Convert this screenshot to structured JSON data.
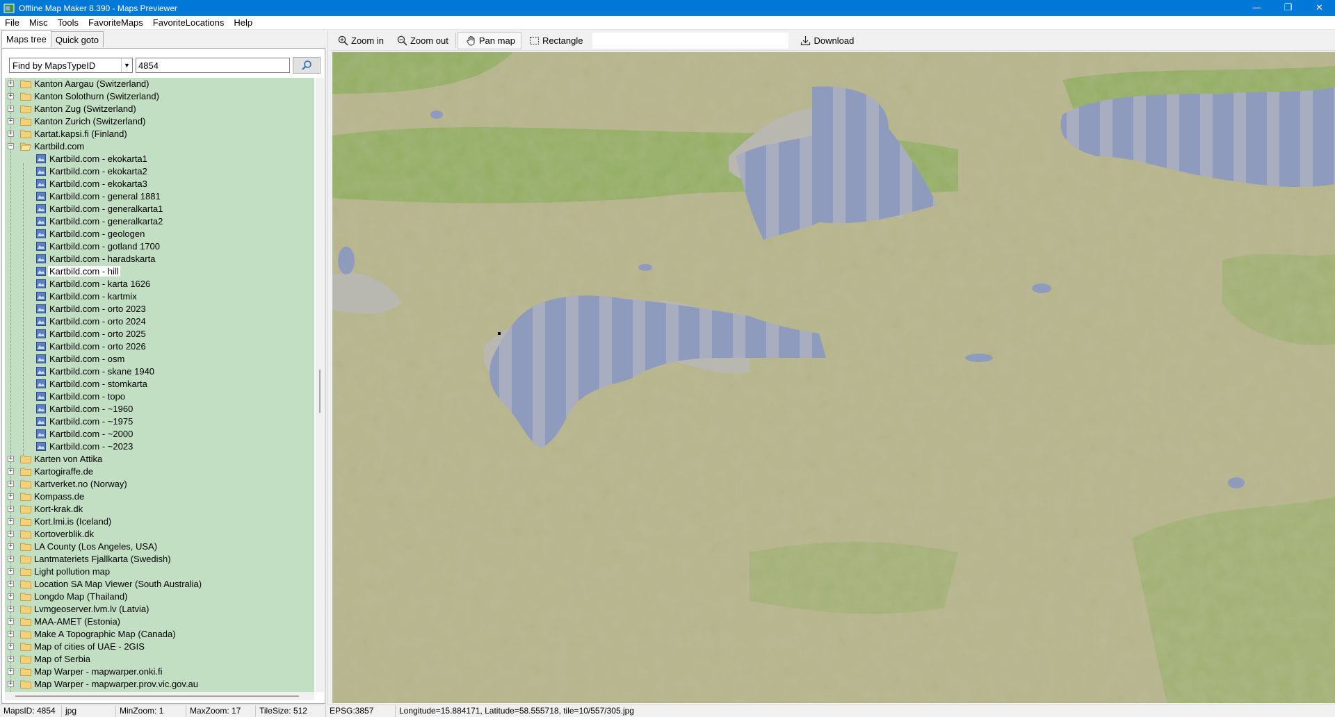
{
  "window": {
    "title": "Offline Map Maker 8.390 - Maps Previewer",
    "minimize": "—",
    "restore": "❐",
    "close": "✕"
  },
  "menu": [
    {
      "label": "File"
    },
    {
      "label": "Misc"
    },
    {
      "label": "Tools"
    },
    {
      "label": "FavoriteMaps"
    },
    {
      "label": "FavoriteLocations"
    },
    {
      "label": "Help"
    }
  ],
  "tabs": {
    "maps_tree": "Maps tree",
    "quick_goto": "Quick goto"
  },
  "search": {
    "mode": "Find by MapsTypeID",
    "value": "4854"
  },
  "tree": {
    "before": [
      "Kanton Aargau (Switzerland)",
      "Kanton Solothurn (Switzerland)",
      "Kanton Zug (Switzerland)",
      "Kanton Zurich (Switzerland)",
      "Kartat.kapsi.fi (Finland)"
    ],
    "expanded": "Kartbild.com",
    "children": [
      "Kartbild.com - ekokarta1",
      "Kartbild.com - ekokarta2",
      "Kartbild.com - ekokarta3",
      "Kartbild.com - general 1881",
      "Kartbild.com - generalkarta1",
      "Kartbild.com - generalkarta2",
      "Kartbild.com - geologen",
      "Kartbild.com - gotland 1700",
      "Kartbild.com - haradskarta",
      "Kartbild.com - hill",
      "Kartbild.com - karta 1626",
      "Kartbild.com - kartmix",
      "Kartbild.com - orto 2023",
      "Kartbild.com - orto 2024",
      "Kartbild.com - orto 2025",
      "Kartbild.com - orto 2026",
      "Kartbild.com - osm",
      "Kartbild.com - skane 1940",
      "Kartbild.com - stomkarta",
      "Kartbild.com - topo",
      "Kartbild.com - ~1960",
      "Kartbild.com - ~1975",
      "Kartbild.com - ~2000",
      "Kartbild.com - ~2023"
    ],
    "selected_index": 9,
    "after": [
      "Karten von Attika",
      "Kartogiraffe.de",
      "Kartverket.no (Norway)",
      "Kompass.de",
      "Kort-krak.dk",
      "Kort.lmi.is (Iceland)",
      "Kortoverblik.dk",
      "LA County (Los Angeles, USA)",
      "Lantmateriets Fjallkarta (Swedish)",
      "Light pollution map",
      "Location SA Map Viewer (South Australia)",
      "Longdo Map (Thailand)",
      "Lvmgeoserver.lvm.lv (Latvia)",
      "MAA-AMET (Estonia)",
      "Make A Topographic Map (Canada)",
      "Map of cities of UAE - 2GIS",
      "Map of Serbia",
      "Map Warper - mapwarper.onki.fi",
      "Map Warper - mapwarper.prov.vic.gov.au"
    ]
  },
  "toolbar": {
    "zoom_in": "Zoom in",
    "zoom_out": "Zoom out",
    "pan_map": "Pan map",
    "rectangle": "Rectangle",
    "download": "Download"
  },
  "status": {
    "maps_id": "MapsID: 4854",
    "format": "jpg",
    "min_zoom": "MinZoom: 1",
    "max_zoom": "MaxZoom: 17",
    "tile_size": "TileSize: 512",
    "epsg": "EPSG:3857",
    "coords": "Longitude=15.884171, Latitude=58.555718, tile=10/557/305.jpg"
  },
  "colors": {
    "titlebar": "#0078d7",
    "tree_bg": "#c2dec3",
    "map_land": "#b6b48a",
    "map_forest": "#86ad55",
    "map_water": "#8e9bbd"
  }
}
